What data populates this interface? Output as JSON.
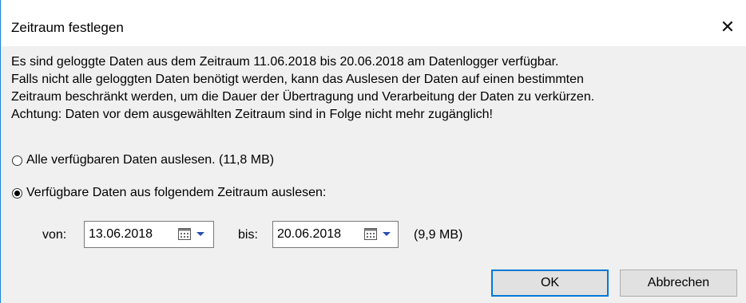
{
  "dialog": {
    "title": "Zeitraum festlegen",
    "close_glyph": "✕",
    "message_lines": [
      "Es sind geloggte Daten aus dem Zeitraum 11.06.2018 bis 20.06.2018 am Datenlogger verfügbar.",
      "Falls nicht alle geloggten Daten benötigt werden, kann das Auslesen der Daten auf einen bestimmten",
      "Zeitraum beschränkt werden, um die Dauer der Übertragung und Verarbeitung der Daten zu verkürzen.",
      "Achtung: Daten vor dem ausgewählten Zeitraum sind in Folge nicht mehr zugänglich!"
    ],
    "options": {
      "all_label": "Alle verfügbaren Daten auslesen. (11,8 MB)",
      "range_label": "Verfügbare Daten aus folgendem Zeitraum auslesen:",
      "selected": "range"
    },
    "range": {
      "from_label": "von:",
      "from_value": "13.06.2018",
      "to_label": "bis:",
      "to_value": "20.06.2018",
      "size": "(9,9 MB)"
    },
    "buttons": {
      "ok": "OK",
      "cancel": "Abbrechen"
    },
    "colors": {
      "accent": "#0078d7",
      "dialog_bg": "#f0f0f0"
    }
  }
}
